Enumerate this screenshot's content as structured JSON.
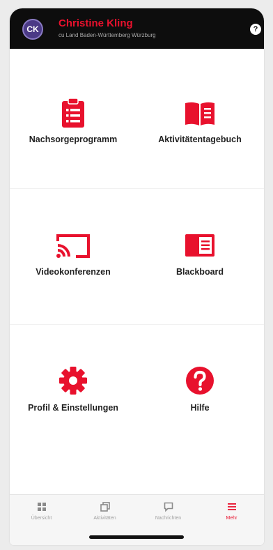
{
  "colors": {
    "accent": "#e8112d",
    "header_bg": "#0d0d0d",
    "tab_inactive": "#a0a0a0"
  },
  "header": {
    "avatar_initials": "CK",
    "user_name": "Christine Kling",
    "subtitle": "cu Land Baden-Württemberg Würzburg",
    "help_icon": "question-circle-icon",
    "help_glyph": "?"
  },
  "tiles": [
    {
      "label": "Nachsorgeprogramm",
      "icon": "clipboard-list-icon"
    },
    {
      "label": "Aktivitätentagebuch",
      "icon": "open-book-icon"
    },
    {
      "label": "Videokonferenzen",
      "icon": "cast-screen-icon"
    },
    {
      "label": "Blackboard",
      "icon": "board-icon"
    },
    {
      "label": "Profil & Einstellungen",
      "icon": "gear-icon"
    },
    {
      "label": "Hilfe",
      "icon": "help-circle-icon"
    }
  ],
  "tabbar": {
    "items": [
      {
        "label": "Übersicht",
        "icon": "grid-icon",
        "active": false
      },
      {
        "label": "Aktivitäten",
        "icon": "stack-icon",
        "active": false
      },
      {
        "label": "Nachrichten",
        "icon": "chat-icon",
        "active": false
      },
      {
        "label": "Mehr",
        "icon": "menu-icon",
        "active": true
      }
    ]
  }
}
